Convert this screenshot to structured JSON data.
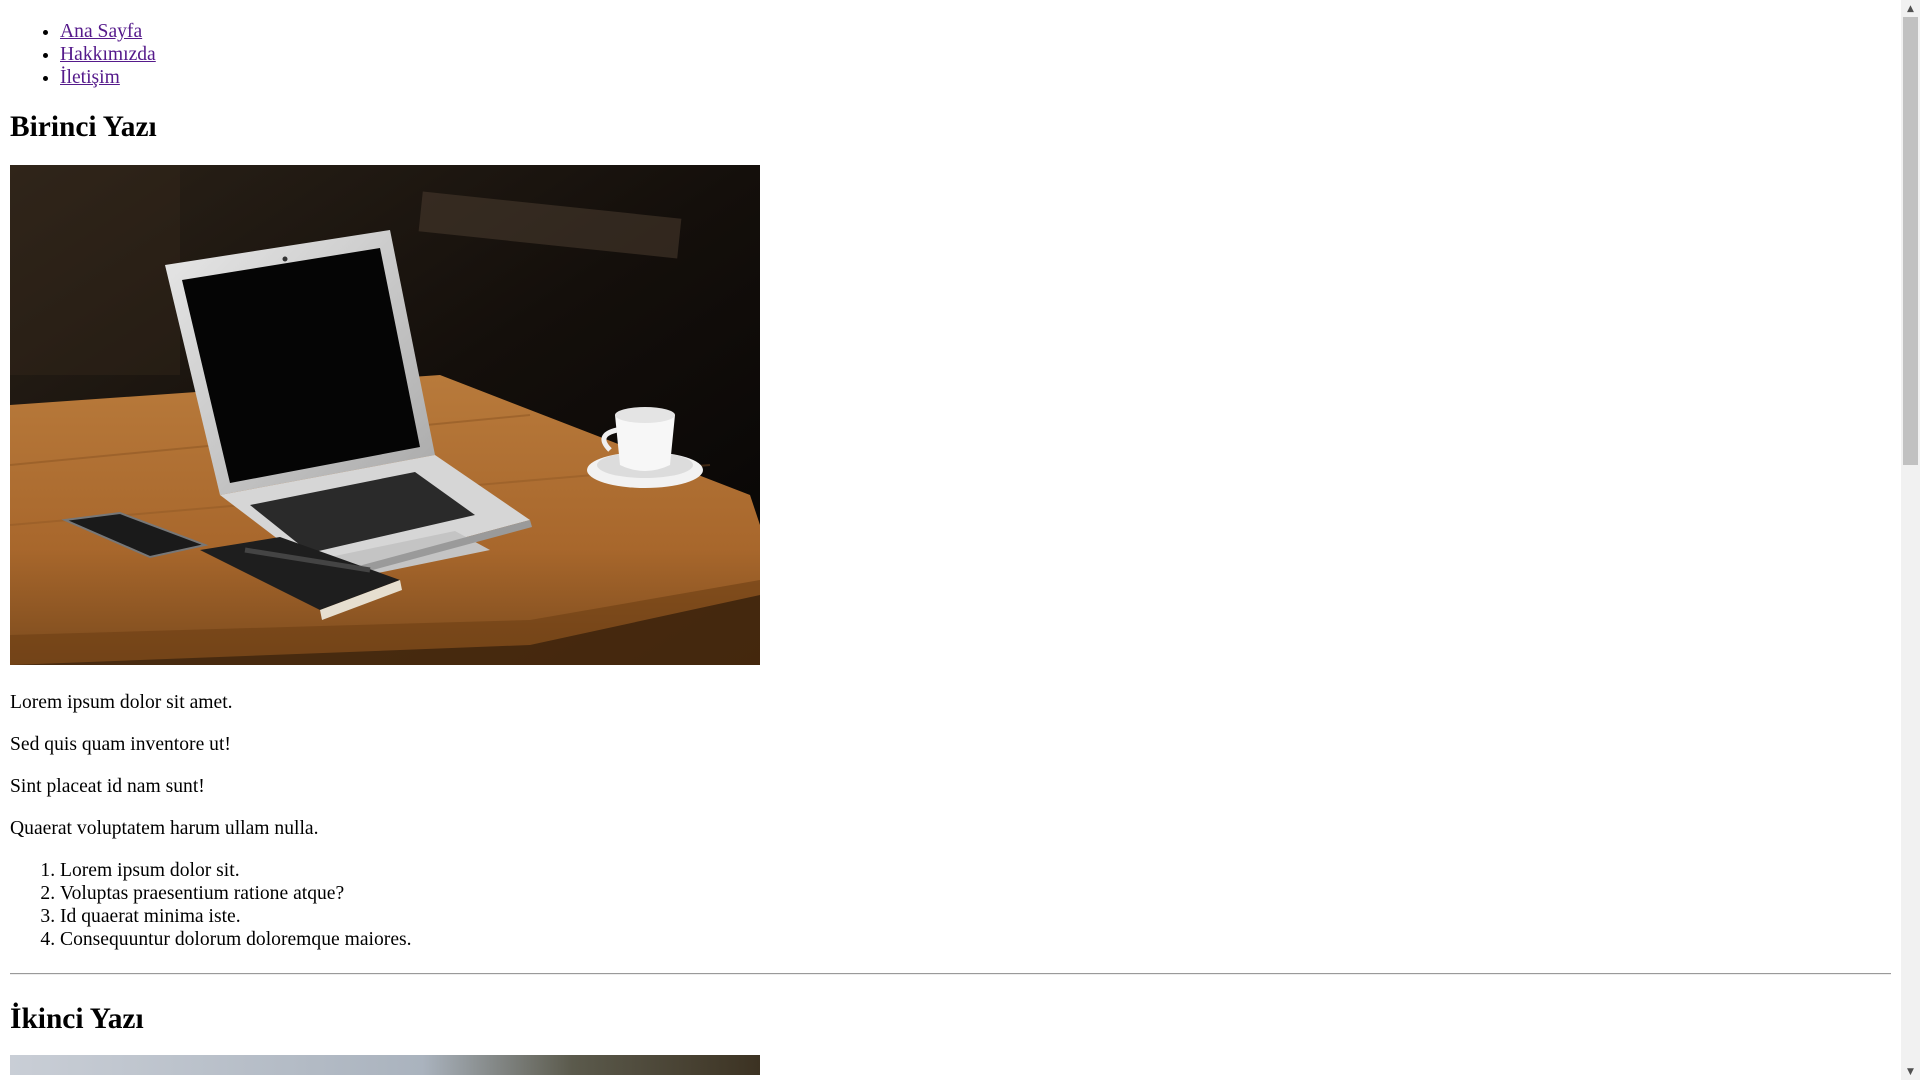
{
  "nav": {
    "items": [
      {
        "label": "Ana Sayfa"
      },
      {
        "label": "Hakkımızda"
      },
      {
        "label": "İletişim"
      }
    ]
  },
  "post1": {
    "title": "Birinci Yazı",
    "paragraphs": [
      "Lorem ipsum dolor sit amet.",
      "Sed quis quam inventore ut!",
      "Sint placeat id nam sunt!",
      "Quaerat voluptatem harum ullam nulla."
    ],
    "list": [
      "Lorem ipsum dolor sit.",
      "Voluptas praesentium ratione atque?",
      "Id quaerat minima iste.",
      "Consequuntur dolorum doloremque maiores."
    ]
  },
  "post2": {
    "title": "İkinci Yazı"
  },
  "colors": {
    "link_visited": "#551a8b",
    "scroll_track": "#f1f1f1",
    "scroll_thumb": "#c1c1c1"
  }
}
